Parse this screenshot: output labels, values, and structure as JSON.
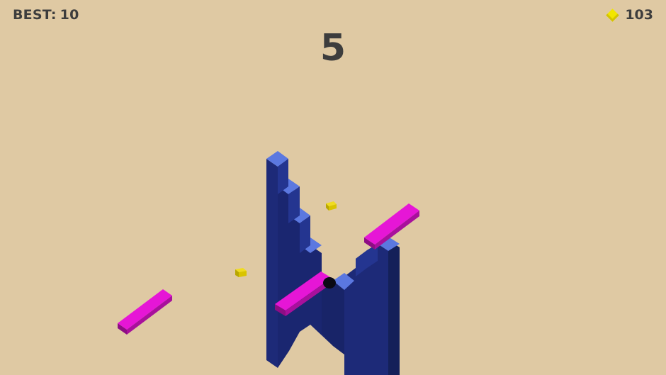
{
  "hud": {
    "best_label": "BEST:",
    "best_value": "10",
    "gem_count": "103",
    "gem_icon": "yellow-diamond-gem",
    "score": "5"
  },
  "colors": {
    "background": "#dfc9a3",
    "tower_front": "#1d2a78",
    "tower_side": "#142059",
    "tower_top": "#5b78e0",
    "platform_top": "#e616d6",
    "platform_side": "#8d0d84",
    "gem": "#d9c400",
    "ball": "#0a0a14",
    "hud_text": "#3d3d3d"
  },
  "scene": {
    "tower_steps": 6,
    "pink_platforms": 3,
    "floating_gems": 2,
    "balls": 1
  }
}
